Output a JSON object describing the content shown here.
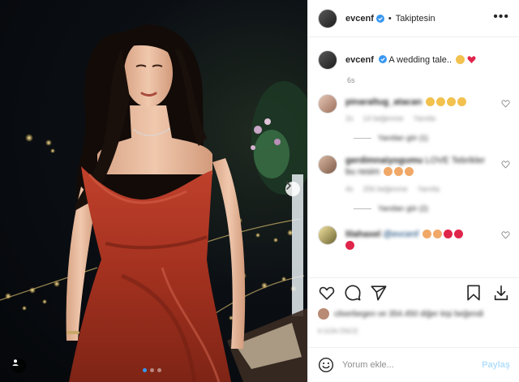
{
  "header": {
    "username": "evcenf",
    "separator": "•",
    "follow_status": "Takiptesin"
  },
  "caption": {
    "username": "evcenf",
    "text": "A wedding tale..",
    "time": "6s"
  },
  "comments": [
    {
      "username": "pinaraltug_atacan",
      "text": "",
      "age": "2s",
      "likes": "14 beğenme",
      "reply_label": "Yanıtla",
      "view_replies": "Yanıtları gör (1)"
    },
    {
      "username": "gerdimnaiyogumu",
      "text": "LOVE Tebrikler bu resim",
      "age": "4s",
      "likes": "256 beğenme",
      "reply_label": "Yanıtla",
      "view_replies": "Yanıtları gör (2)"
    },
    {
      "username": "lilahaxel",
      "mention": "@evcenf",
      "text": ""
    }
  ],
  "likes_text": "cilxerbegen ve 354.450 diğer kişi beğendi",
  "date_text": "6 GÜN ÖNCE",
  "compose": {
    "placeholder": "Yorum ekle...",
    "share_label": "Paylaş"
  },
  "colors": {
    "verified": "#3897f0",
    "heart": "#e0254a",
    "share_disabled": "#b2dffc"
  },
  "icons": [
    "verified-badge-icon",
    "more-options-icon",
    "like-icon",
    "comment-icon",
    "share-icon",
    "save-icon",
    "download-icon",
    "emoji-icon",
    "next-arrow-icon",
    "user-tag-icon"
  ]
}
